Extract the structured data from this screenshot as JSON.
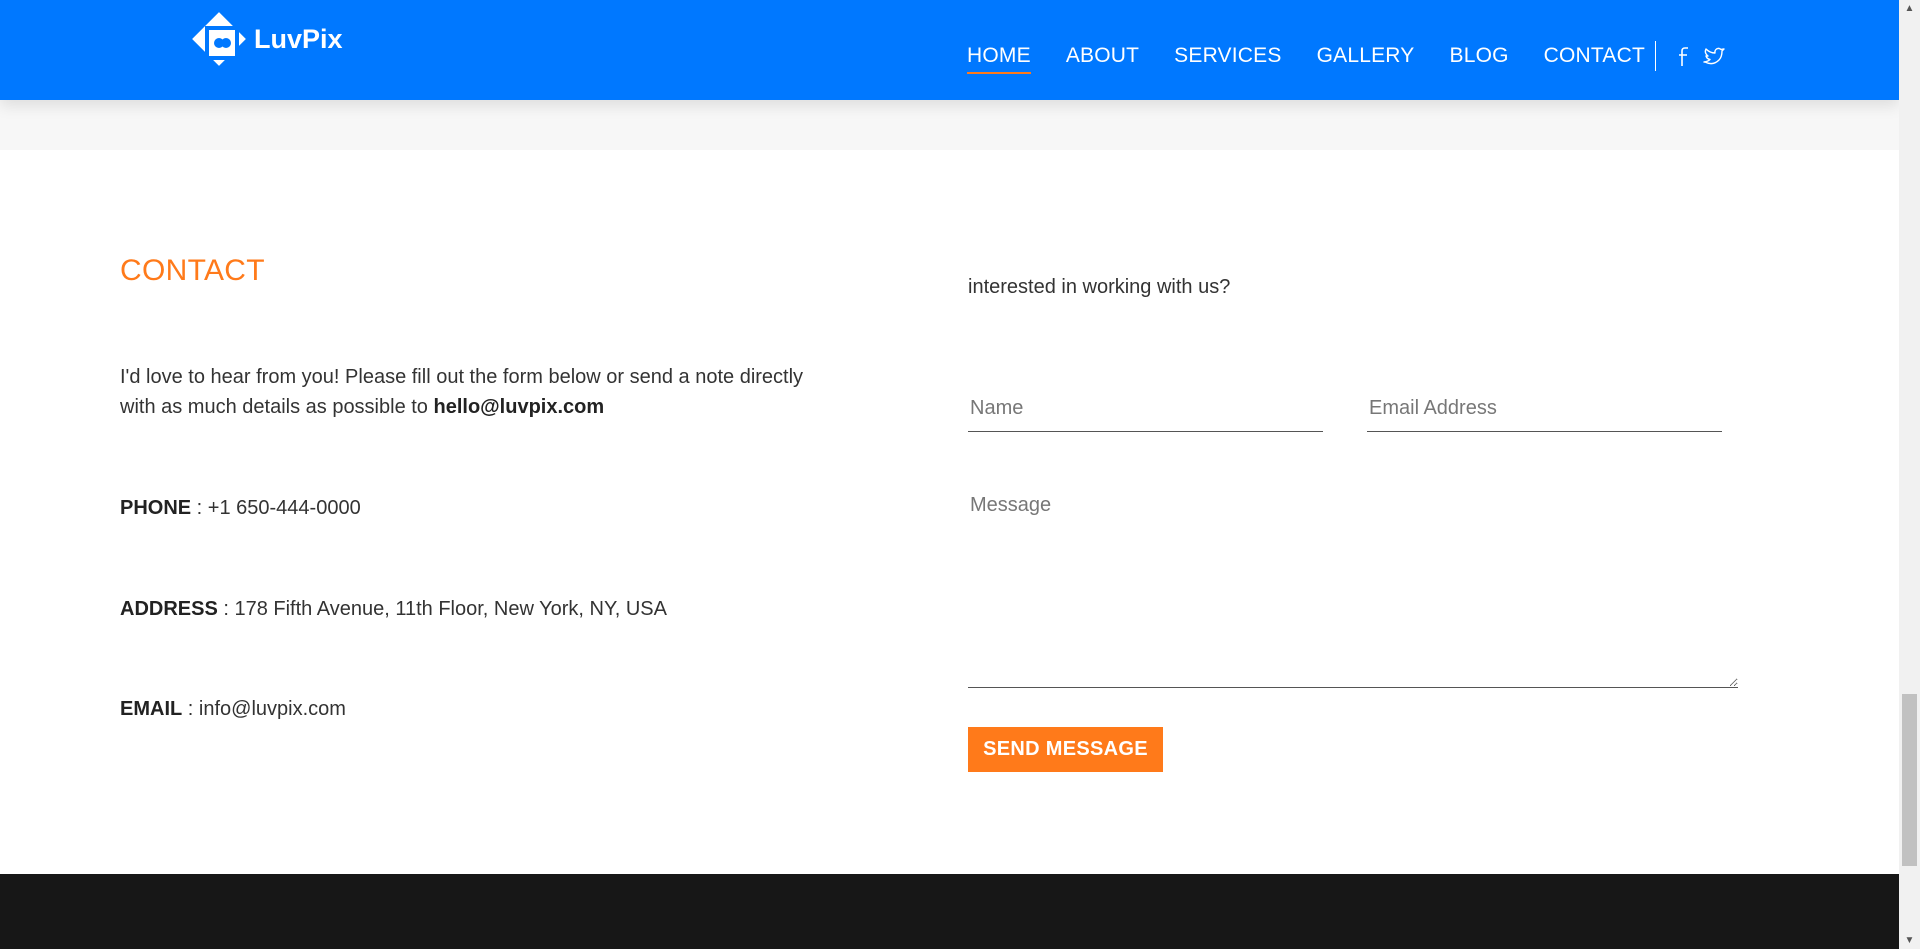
{
  "header": {
    "brand": "LuvPix",
    "nav": [
      {
        "label": "HOME",
        "active": true
      },
      {
        "label": "ABOUT",
        "active": false
      },
      {
        "label": "SERVICES",
        "active": false
      },
      {
        "label": "GALLERY",
        "active": false
      },
      {
        "label": "BLOG",
        "active": false
      },
      {
        "label": "CONTACT",
        "active": false
      }
    ],
    "social": [
      "facebook-icon",
      "twitter-icon"
    ]
  },
  "contact": {
    "title": "CONTACT",
    "intro_text": "I'd love to hear from you! Please fill out the form below or send a note directly with as much details as possible to ",
    "intro_email": "hello@luvpix.com",
    "phone_label": "PHONE",
    "phone_value": " : +1 650-444-0000",
    "address_label": "ADDRESS",
    "address_value": " : 178 Fifth Avenue, 11th Floor, New York, NY, USA",
    "email_label": "EMAIL",
    "email_value": " : info@luvpix.com"
  },
  "form": {
    "lead": "interested in working with us?",
    "name_placeholder": "Name",
    "email_placeholder": "Email Address",
    "message_placeholder": "Message",
    "submit_label": "SEND MESSAGE"
  },
  "colors": {
    "header_bg": "#0078ff",
    "accent": "#ff7a1a",
    "footer_bg": "#171717"
  }
}
